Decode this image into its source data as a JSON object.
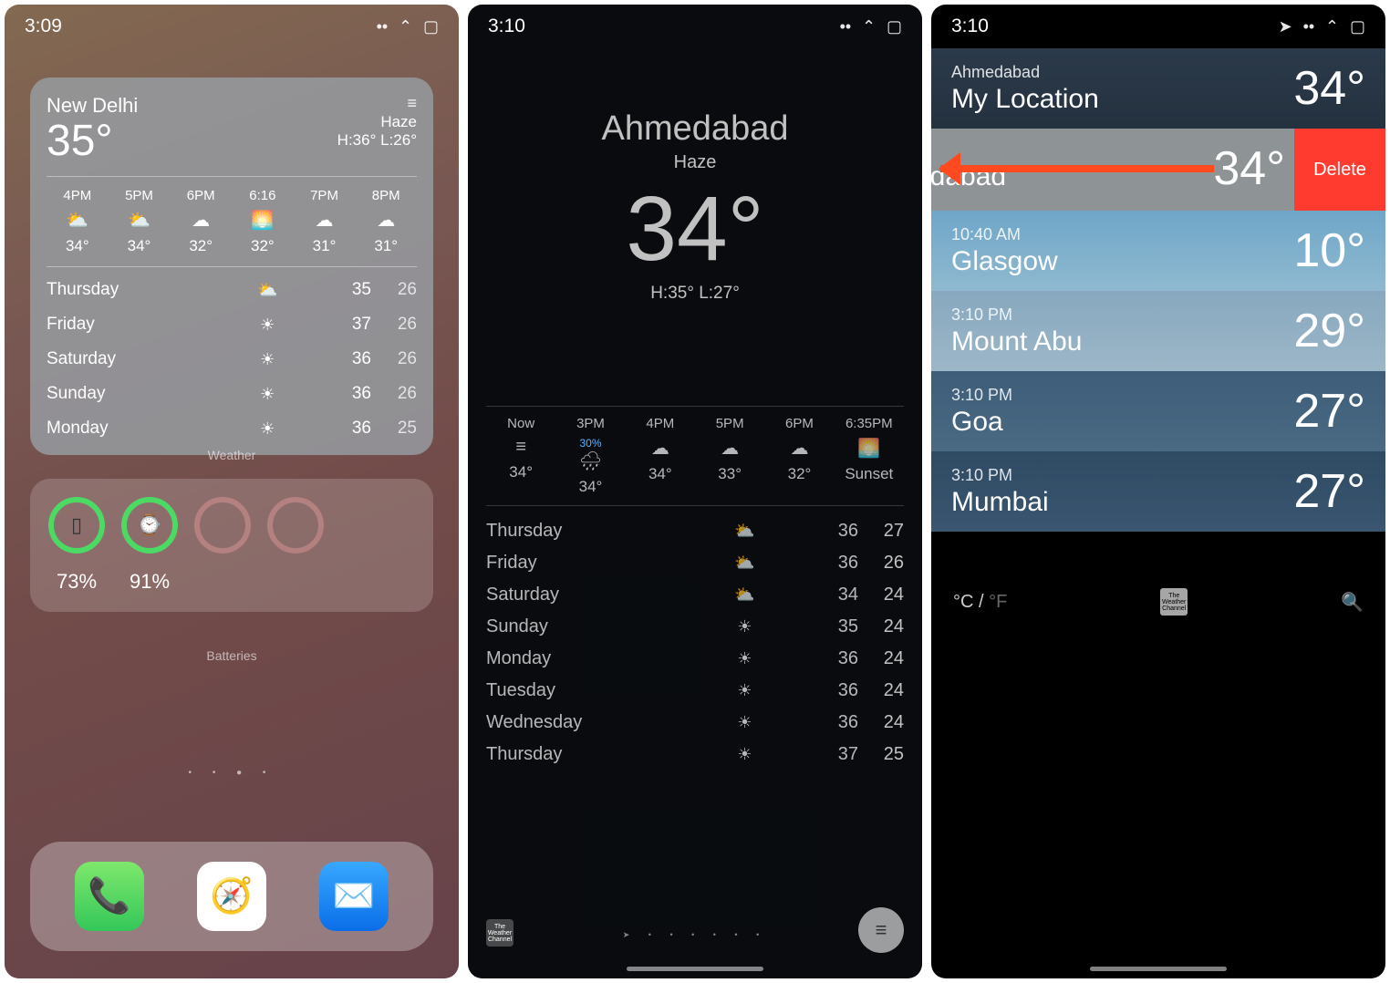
{
  "s1": {
    "time": "3:09",
    "signal": "••",
    "wifi": "⌃",
    "battery": "▢",
    "widget": {
      "city": "New Delhi",
      "temp": "35°",
      "cond_icon": "≡",
      "cond": "Haze",
      "hilo": "H:36° L:26°",
      "hourly": [
        {
          "time": "4PM",
          "icon": "⛅",
          "temp": "34°"
        },
        {
          "time": "5PM",
          "icon": "⛅",
          "temp": "34°"
        },
        {
          "time": "6PM",
          "icon": "☁︎",
          "temp": "32°"
        },
        {
          "time": "6:16",
          "icon": "🌅",
          "temp": "32°"
        },
        {
          "time": "7PM",
          "icon": "☁︎",
          "temp": "31°"
        },
        {
          "time": "8PM",
          "icon": "☁︎",
          "temp": "31°"
        }
      ],
      "daily": [
        {
          "day": "Thursday",
          "icon": "⛅",
          "hi": "35",
          "lo": "26"
        },
        {
          "day": "Friday",
          "icon": "☀︎",
          "hi": "37",
          "lo": "26"
        },
        {
          "day": "Saturday",
          "icon": "☀︎",
          "hi": "36",
          "lo": "26"
        },
        {
          "day": "Sunday",
          "icon": "☀︎",
          "hi": "36",
          "lo": "26"
        },
        {
          "day": "Monday",
          "icon": "☀︎",
          "hi": "36",
          "lo": "25"
        }
      ],
      "label": "Weather"
    },
    "batteries": {
      "phone": "73%",
      "watch": "91%",
      "label": "Batteries"
    },
    "dock": {
      "phone": "📞",
      "safari": "🧭",
      "mail": "✉️"
    }
  },
  "s2": {
    "time": "3:10",
    "city": "Ahmedabad",
    "cond": "Haze",
    "temp": "34°",
    "hilo": "H:35°  L:27°",
    "hourly": [
      {
        "time": "Now",
        "pct": "",
        "icon": "≡",
        "temp": "34°"
      },
      {
        "time": "3PM",
        "pct": "30%",
        "icon": "🌧",
        "temp": "34°"
      },
      {
        "time": "4PM",
        "pct": "",
        "icon": "☁︎",
        "temp": "34°"
      },
      {
        "time": "5PM",
        "pct": "",
        "icon": "☁︎",
        "temp": "33°"
      },
      {
        "time": "6PM",
        "pct": "",
        "icon": "☁︎",
        "temp": "32°"
      },
      {
        "time": "6:35PM",
        "pct": "",
        "icon": "🌅",
        "temp": "Sunset"
      }
    ],
    "daily": [
      {
        "day": "Thursday",
        "icon": "⛅",
        "hi": "36",
        "lo": "27"
      },
      {
        "day": "Friday",
        "icon": "⛅",
        "hi": "36",
        "lo": "26"
      },
      {
        "day": "Saturday",
        "icon": "⛅",
        "hi": "34",
        "lo": "24"
      },
      {
        "day": "Sunday",
        "icon": "☀︎",
        "hi": "35",
        "lo": "24"
      },
      {
        "day": "Monday",
        "icon": "☀︎",
        "hi": "36",
        "lo": "24"
      },
      {
        "day": "Tuesday",
        "icon": "☀︎",
        "hi": "36",
        "lo": "24"
      },
      {
        "day": "Wednesday",
        "icon": "☀︎",
        "hi": "36",
        "lo": "24"
      },
      {
        "day": "Thursday",
        "icon": "☀︎",
        "hi": "37",
        "lo": "25"
      }
    ],
    "twc": "The Weather Channel",
    "dots": "➤ • • • • • •",
    "list": "≡"
  },
  "s3": {
    "time": "3:10",
    "myloc": {
      "sub": "Ahmedabad",
      "title": "My Location",
      "temp": "34°"
    },
    "swiped": {
      "name": "edabad",
      "temp": "34°",
      "delete": "Delete"
    },
    "rows": [
      {
        "time": "10:40 AM",
        "name": "Glasgow",
        "temp": "10°"
      },
      {
        "time": "3:10 PM",
        "name": "Mount Abu",
        "temp": "29°"
      },
      {
        "time": "3:10 PM",
        "name": "Goa",
        "temp": "27°"
      },
      {
        "time": "3:10 PM",
        "name": "Mumbai",
        "temp": "27°"
      }
    ],
    "unit_c": "°C",
    "unit_sep": " / ",
    "unit_f": "°F",
    "twc": "The Weather Channel",
    "search": "🔍"
  }
}
